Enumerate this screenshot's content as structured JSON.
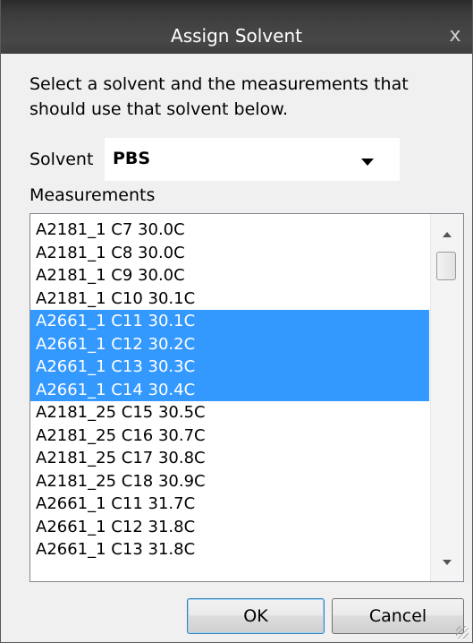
{
  "window": {
    "title": "Assign Solvent",
    "close_glyph": "x"
  },
  "instructions": "Select a solvent and the measurements that should use that  solvent below.",
  "solvent": {
    "label": "Solvent",
    "selected": "PBS"
  },
  "measurements": {
    "label": "Measurements",
    "items": [
      {
        "text": "A2181_1 C7 30.0C",
        "selected": false
      },
      {
        "text": "A2181_1 C8 30.0C",
        "selected": false
      },
      {
        "text": "A2181_1 C9 30.0C",
        "selected": false
      },
      {
        "text": "A2181_1 C10 30.1C",
        "selected": false
      },
      {
        "text": "A2661_1 C11 30.1C",
        "selected": true
      },
      {
        "text": "A2661_1 C12 30.2C",
        "selected": true
      },
      {
        "text": "A2661_1 C13 30.3C",
        "selected": true
      },
      {
        "text": "A2661_1 C14 30.4C",
        "selected": true
      },
      {
        "text": "A2181_25 C15 30.5C",
        "selected": false
      },
      {
        "text": "A2181_25 C16 30.7C",
        "selected": false
      },
      {
        "text": "A2181_25 C17 30.8C",
        "selected": false
      },
      {
        "text": "A2181_25 C18 30.9C",
        "selected": false
      },
      {
        "text": "A2661_1 C11 31.7C",
        "selected": false
      },
      {
        "text": "A2661_1 C12 31.8C",
        "selected": false
      },
      {
        "text": "A2661_1 C13 31.8C",
        "selected": false
      }
    ]
  },
  "buttons": {
    "ok": "OK",
    "cancel": "Cancel"
  },
  "colors": {
    "selection": "#3399ff",
    "title_bar": "#3e3e3e"
  }
}
